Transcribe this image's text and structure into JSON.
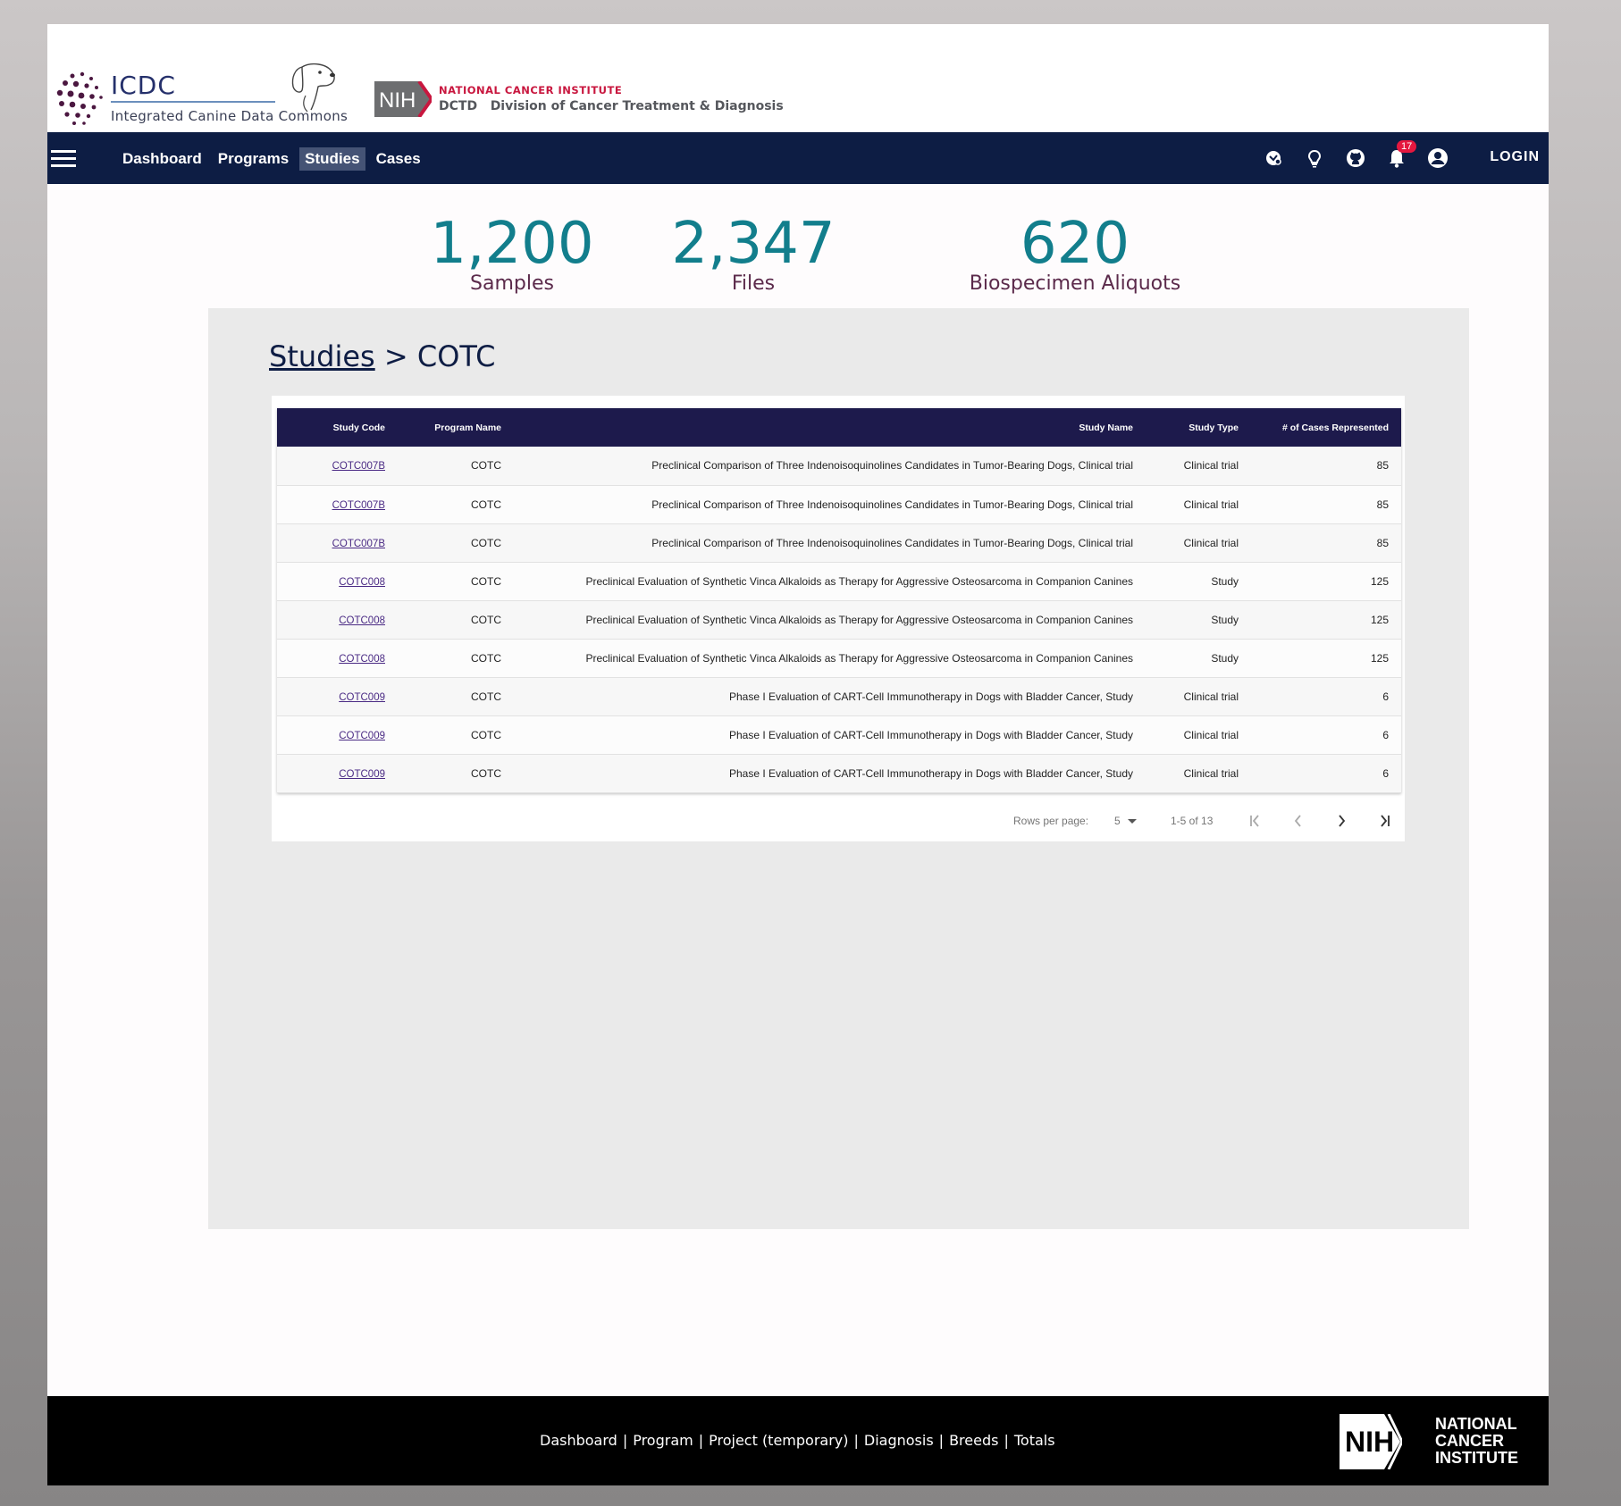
{
  "header": {
    "logo_title": "ICDC",
    "logo_subtitle": "Integrated Canine Data Commons",
    "nih_badge": "NIH",
    "nci_title": "NATIONAL CANCER INSTITUTE",
    "dctd_text": "DCTD   Division of Cancer Treatment & Diagnosis"
  },
  "nav": {
    "items": [
      {
        "label": "Dashboard",
        "active": false
      },
      {
        "label": "Programs",
        "active": false
      },
      {
        "label": "Studies",
        "active": true
      },
      {
        "label": "Cases",
        "active": false
      }
    ],
    "notification_count": "17",
    "login_label": "LOGIN",
    "icons": [
      "brain-icon",
      "lightbulb-icon",
      "github-icon",
      "bell-icon",
      "account-icon"
    ]
  },
  "stats": [
    {
      "value": "1,200",
      "label": "Samples"
    },
    {
      "value": "2,347",
      "label": "Files"
    },
    {
      "value": "620",
      "label": "Biospecimen Aliquots"
    }
  ],
  "breadcrumb": {
    "link": "Studies",
    "separator": ">",
    "current": "COTC"
  },
  "table": {
    "columns": [
      "Study Code",
      "Program Name",
      "Study Name",
      "Study Type",
      "# of Cases Represented"
    ],
    "rows": [
      [
        "COTC007B",
        "COTC",
        "Preclinical Comparison of Three Indenoisoquinolines Candidates in Tumor-Bearing Dogs, Clinical trial",
        "Clinical trial",
        "85"
      ],
      [
        "COTC007B",
        "COTC",
        "Preclinical Comparison of Three Indenoisoquinolines Candidates in Tumor-Bearing Dogs, Clinical trial",
        "Clinical trial",
        "85"
      ],
      [
        "COTC007B",
        "COTC",
        "Preclinical Comparison of Three Indenoisoquinolines Candidates in Tumor-Bearing Dogs, Clinical trial",
        "Clinical trial",
        "85"
      ],
      [
        "COTC008",
        "COTC",
        "Preclinical Evaluation of Synthetic Vinca Alkaloids as Therapy for Aggressive Osteosarcoma in Companion Canines",
        "Study",
        "125"
      ],
      [
        "COTC008",
        "COTC",
        "Preclinical Evaluation of Synthetic Vinca Alkaloids as Therapy for Aggressive Osteosarcoma in Companion Canines",
        "Study",
        "125"
      ],
      [
        "COTC008",
        "COTC",
        "Preclinical Evaluation of Synthetic Vinca Alkaloids as Therapy for Aggressive Osteosarcoma in Companion Canines",
        "Study",
        "125"
      ],
      [
        "COTC009",
        "COTC",
        "Phase I Evaluation of CART-Cell Immunotherapy in Dogs with Bladder Cancer, Study",
        "Clinical trial",
        "6"
      ],
      [
        "COTC009",
        "COTC",
        "Phase I Evaluation of CART-Cell Immunotherapy in Dogs with Bladder Cancer, Study",
        "Clinical trial",
        "6"
      ],
      [
        "COTC009",
        "COTC",
        "Phase I Evaluation of CART-Cell Immunotherapy in Dogs with Bladder Cancer, Study",
        "Clinical trial",
        "6"
      ]
    ],
    "pagination": {
      "rows_per_page_label": "Rows per page:",
      "rows_per_page_value": "5",
      "range": "1-5 of 13"
    }
  },
  "footer": {
    "links": [
      "Dashboard",
      "Program",
      "Project (temporary)",
      "Diagnosis",
      "Breeds",
      "Totals"
    ],
    "nih_badge": "NIH",
    "nci_lines": [
      "NATIONAL",
      "CANCER",
      "INSTITUTE"
    ]
  },
  "colors": {
    "navbar": "#0d1d44",
    "stat_number": "#127e8c",
    "stat_label": "#5b2a4b",
    "table_header": "#1d1a4c",
    "badge": "#e5173f"
  }
}
